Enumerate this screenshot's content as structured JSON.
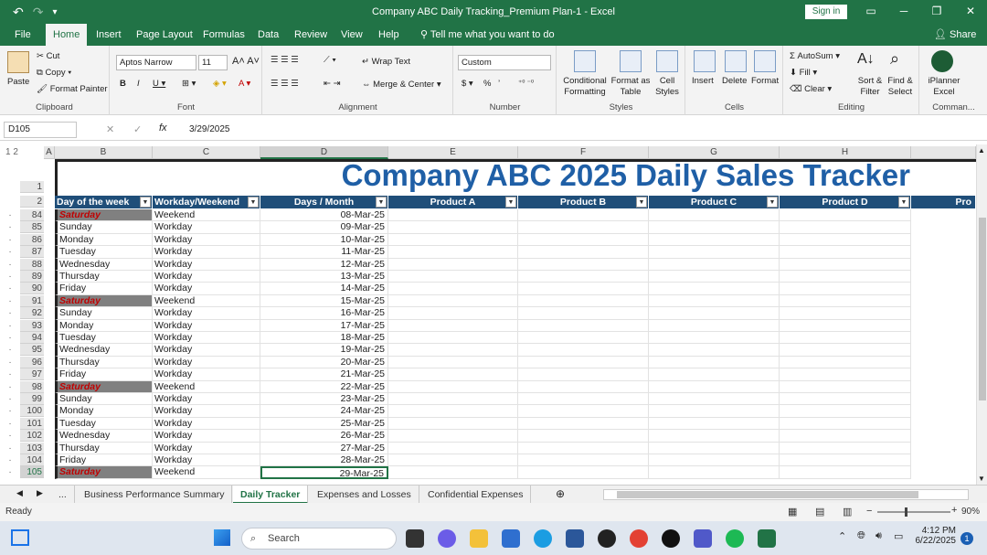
{
  "window": {
    "title": "Company ABC Daily Tracking_Premium Plan-1  -  Excel",
    "sign_in": "Sign in"
  },
  "tabs": [
    "File",
    "Home",
    "Insert",
    "Page Layout",
    "Formulas",
    "Data",
    "Review",
    "View",
    "Help"
  ],
  "tell_me": "Tell me what you want to do",
  "share": "Share",
  "ribbon": {
    "clipboard": {
      "paste": "Paste",
      "cut": "Cut",
      "copy": "Copy",
      "format_painter": "Format Painter",
      "label": "Clipboard"
    },
    "font": {
      "name": "Aptos Narrow",
      "size": "11",
      "label": "Font"
    },
    "alignment": {
      "wrap": "Wrap Text",
      "merge": "Merge & Center",
      "label": "Alignment"
    },
    "number": {
      "format": "Custom",
      "currency": "$",
      "percent": "%",
      "comma": "’",
      "label": "Number"
    },
    "styles": {
      "cond": "Conditional Formatting",
      "table": "Format as Table",
      "cell": "Cell Styles",
      "label": "Styles"
    },
    "cells": {
      "insert": "Insert",
      "delete": "Delete",
      "format": "Format",
      "label": "Cells"
    },
    "editing": {
      "autosum": "AutoSum",
      "fill": "Fill",
      "clear": "Clear",
      "sort": "Sort & Filter",
      "find": "Find & Select",
      "label": "Editing"
    },
    "addin": {
      "name": "iPlanner Excel",
      "label": "Comman..."
    }
  },
  "formula_bar": {
    "name_box": "D105",
    "fx": "fx",
    "value": "3/29/2025"
  },
  "columns": [
    "A",
    "B",
    "C",
    "D",
    "E",
    "F",
    "G",
    "H"
  ],
  "sheet": {
    "title": "Company ABC 2025 Daily Sales Tracker",
    "headers": [
      "Day of the week",
      "Workday/Weekend",
      "Days / Month",
      "Product A",
      "Product B",
      "Product C",
      "Product D",
      "Pro"
    ],
    "rows": [
      {
        "n": "84",
        "day": "Saturday",
        "type": "Weekend",
        "date": "08-Mar-25"
      },
      {
        "n": "85",
        "day": "Sunday",
        "type": "Workday",
        "date": "09-Mar-25"
      },
      {
        "n": "86",
        "day": "Monday",
        "type": "Workday",
        "date": "10-Mar-25"
      },
      {
        "n": "87",
        "day": "Tuesday",
        "type": "Workday",
        "date": "11-Mar-25"
      },
      {
        "n": "88",
        "day": "Wednesday",
        "type": "Workday",
        "date": "12-Mar-25"
      },
      {
        "n": "89",
        "day": "Thursday",
        "type": "Workday",
        "date": "13-Mar-25"
      },
      {
        "n": "90",
        "day": "Friday",
        "type": "Workday",
        "date": "14-Mar-25"
      },
      {
        "n": "91",
        "day": "Saturday",
        "type": "Weekend",
        "date": "15-Mar-25"
      },
      {
        "n": "92",
        "day": "Sunday",
        "type": "Workday",
        "date": "16-Mar-25"
      },
      {
        "n": "93",
        "day": "Monday",
        "type": "Workday",
        "date": "17-Mar-25"
      },
      {
        "n": "94",
        "day": "Tuesday",
        "type": "Workday",
        "date": "18-Mar-25"
      },
      {
        "n": "95",
        "day": "Wednesday",
        "type": "Workday",
        "date": "19-Mar-25"
      },
      {
        "n": "96",
        "day": "Thursday",
        "type": "Workday",
        "date": "20-Mar-25"
      },
      {
        "n": "97",
        "day": "Friday",
        "type": "Workday",
        "date": "21-Mar-25"
      },
      {
        "n": "98",
        "day": "Saturday",
        "type": "Weekend",
        "date": "22-Mar-25"
      },
      {
        "n": "99",
        "day": "Sunday",
        "type": "Workday",
        "date": "23-Mar-25"
      },
      {
        "n": "100",
        "day": "Monday",
        "type": "Workday",
        "date": "24-Mar-25"
      },
      {
        "n": "101",
        "day": "Tuesday",
        "type": "Workday",
        "date": "25-Mar-25"
      },
      {
        "n": "102",
        "day": "Wednesday",
        "type": "Workday",
        "date": "26-Mar-25"
      },
      {
        "n": "103",
        "day": "Thursday",
        "type": "Workday",
        "date": "27-Mar-25"
      },
      {
        "n": "104",
        "day": "Friday",
        "type": "Workday",
        "date": "28-Mar-25"
      },
      {
        "n": "105",
        "day": "Saturday",
        "type": "Weekend",
        "date": "29-Mar-25"
      }
    ]
  },
  "sheet_tabs": [
    "...",
    "Business Performance Summary",
    "Daily Tracker",
    "Expenses and Losses",
    "Confidential Expenses"
  ],
  "status": {
    "ready": "Ready",
    "zoom": "90%"
  },
  "taskbar": {
    "search": "Search",
    "time": "4:12 PM",
    "date": "6/22/2025",
    "badge": "1"
  },
  "colors": {
    "excel_green": "#217346",
    "header_blue": "#1f4e79",
    "title_blue": "#1f5fa6",
    "saturday_red": "#c00000"
  }
}
